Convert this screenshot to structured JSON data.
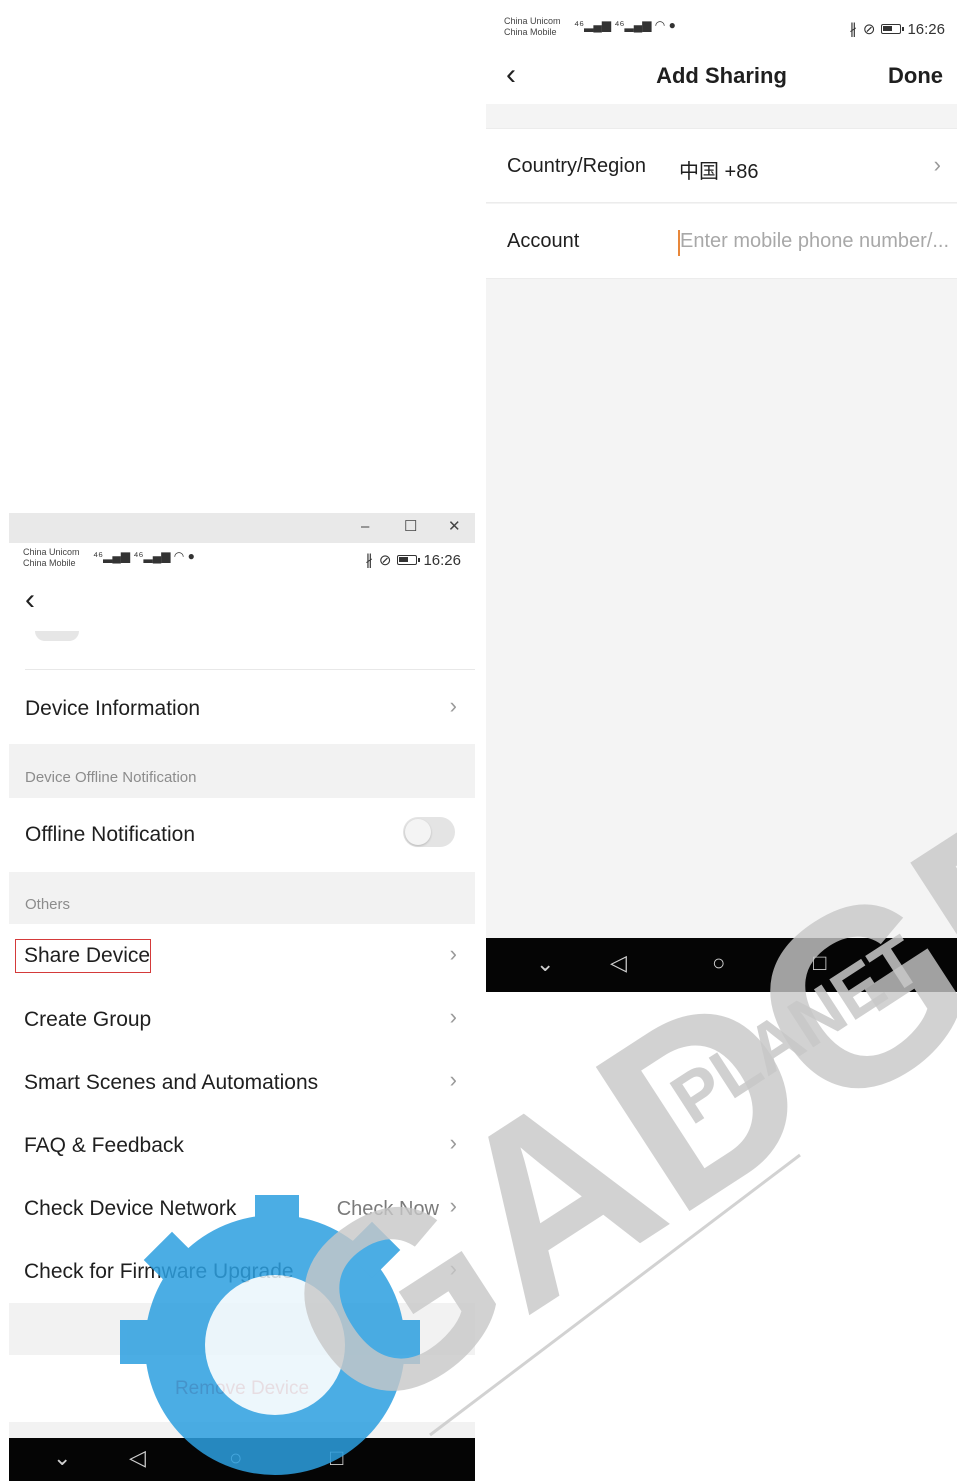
{
  "status_bar": {
    "carrier_1": "China Unicom",
    "carrier_2": "China Mobile",
    "time": "16:26"
  },
  "add_sharing": {
    "title": "Add Sharing",
    "done_label": "Done",
    "country_label": "Country/Region",
    "country_value": "中国 +86",
    "account_label": "Account",
    "account_placeholder": "Enter mobile phone number/..."
  },
  "device_settings": {
    "device_information": "Device Information",
    "offline_section": "Device Offline Notification",
    "offline_notification": "Offline Notification",
    "offline_notification_on": false,
    "others_section": "Others",
    "items": [
      {
        "label": "Share Device",
        "value": ""
      },
      {
        "label": "Create Group",
        "value": ""
      },
      {
        "label": "Smart Scenes and Automations",
        "value": ""
      },
      {
        "label": "FAQ & Feedback",
        "value": ""
      },
      {
        "label": "Check Device Network",
        "value": "Check Now"
      },
      {
        "label": "Check for Firmware Upgrade",
        "value": ""
      }
    ],
    "remove_device": "Remove Device"
  },
  "watermark": {
    "main": "GADGET",
    "sub": "PLANET"
  },
  "colors": {
    "accent": "#e8873a",
    "remove": "#d9534f",
    "highlight_border": "#d43a3a",
    "watermark_gray": "#c8c8c8",
    "watermark_blue": "#2c9fe0"
  }
}
